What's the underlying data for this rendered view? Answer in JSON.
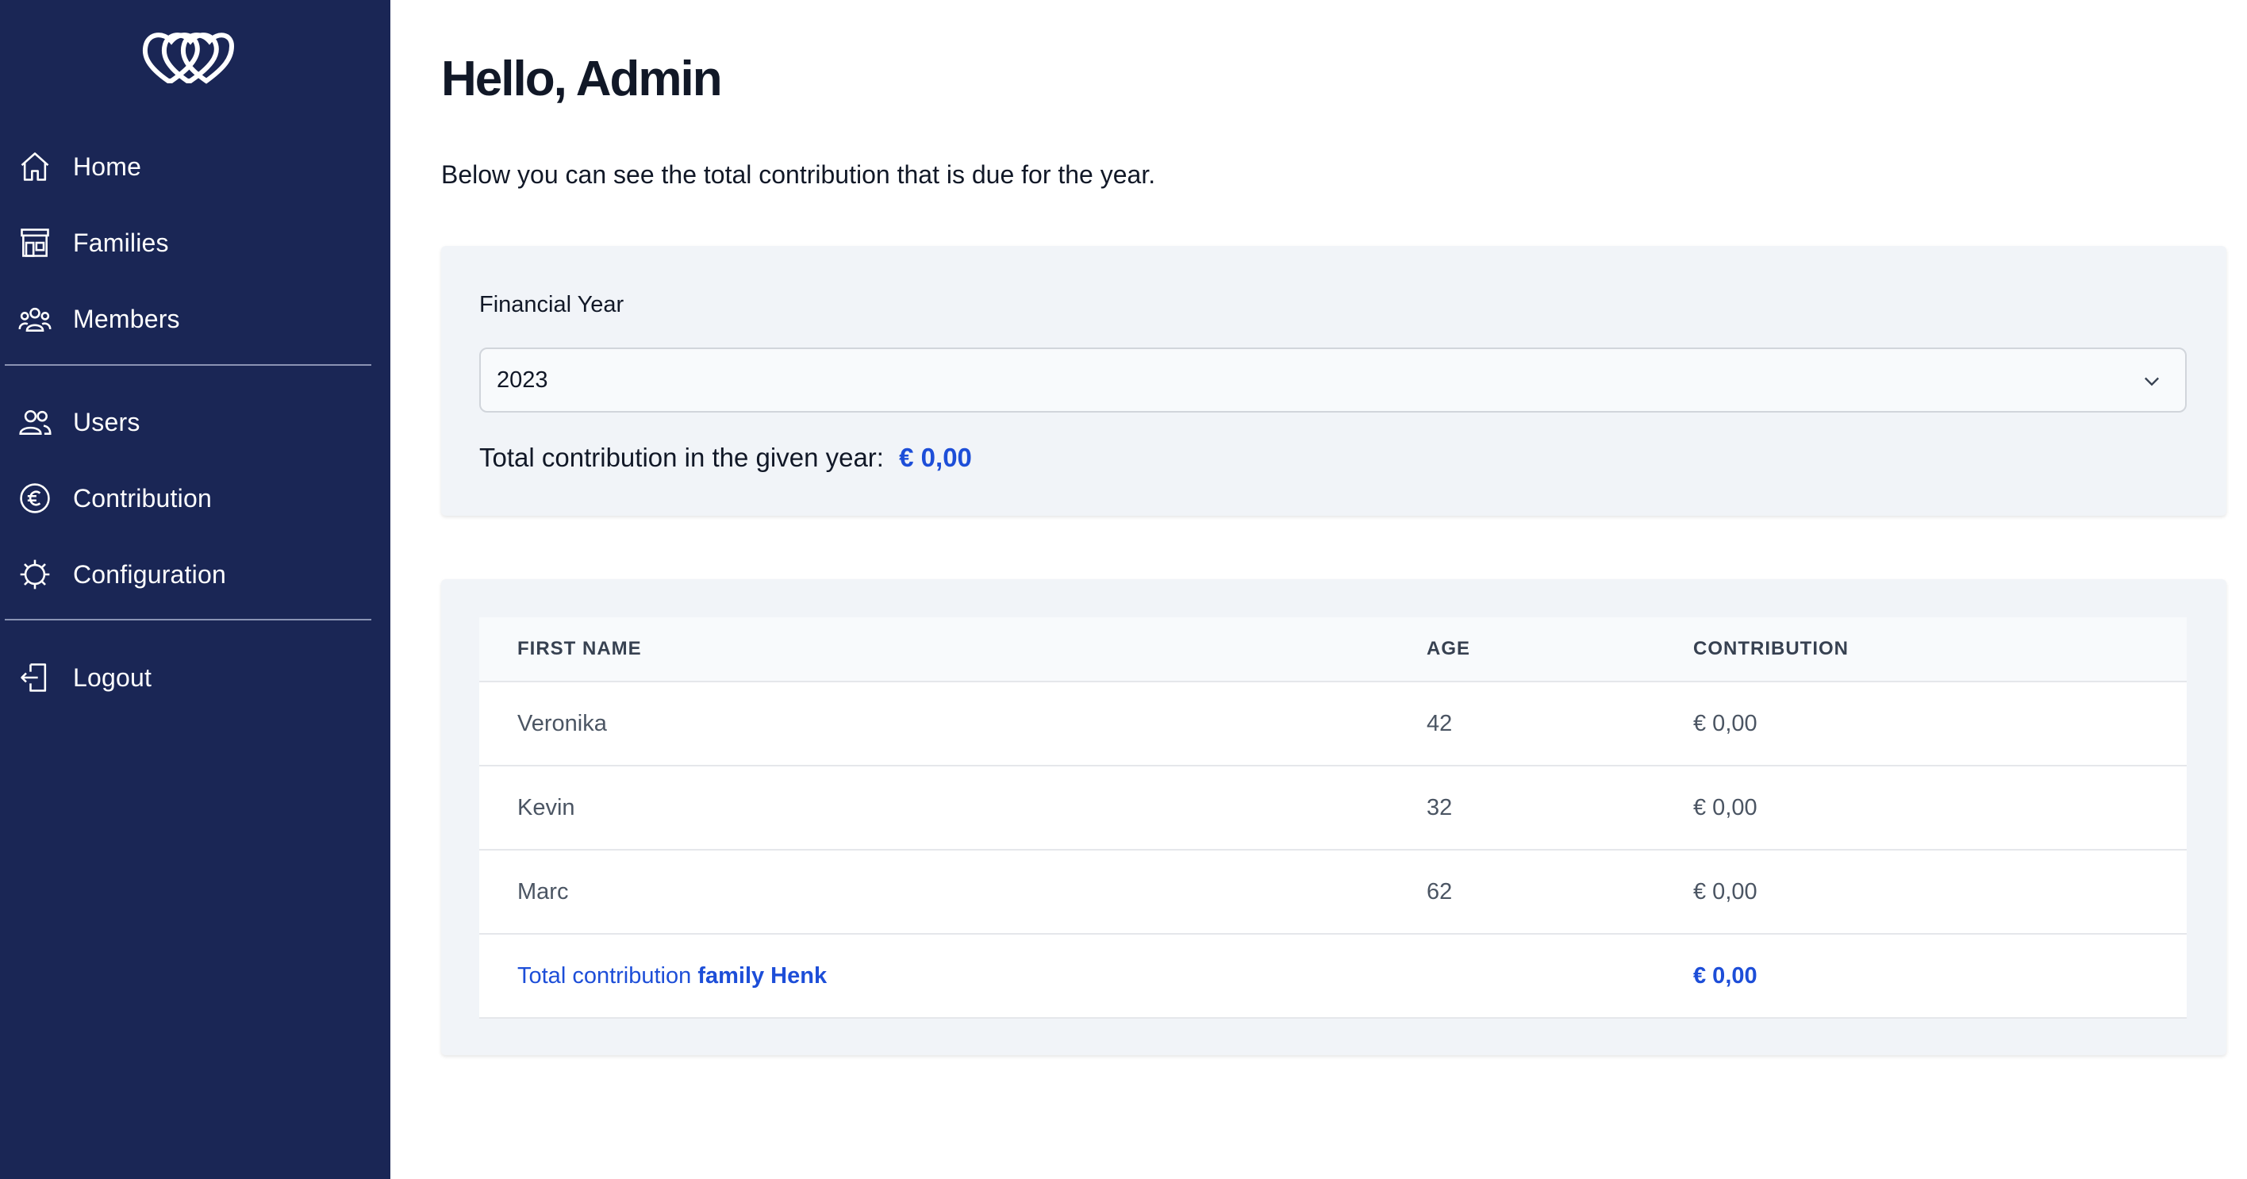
{
  "sidebar": {
    "nav_primary": [
      {
        "label": "Home",
        "icon": "home-icon"
      },
      {
        "label": "Families",
        "icon": "families-icon"
      },
      {
        "label": "Members",
        "icon": "members-icon"
      }
    ],
    "nav_secondary": [
      {
        "label": "Users",
        "icon": "users-icon"
      },
      {
        "label": "Contribution",
        "icon": "euro-icon"
      },
      {
        "label": "Configuration",
        "icon": "gear-icon"
      }
    ],
    "logout": {
      "label": "Logout",
      "icon": "logout-icon"
    }
  },
  "main": {
    "title": "Hello, Admin",
    "intro": "Below you can see the total contribution that is due for the year.",
    "year_card": {
      "field_label": "Financial Year",
      "selected_year": "2023",
      "total_label": "Total contribution in the given year:",
      "total_amount": "€ 0,00"
    },
    "table": {
      "headers": [
        "FIRST NAME",
        "AGE",
        "CONTRIBUTION"
      ],
      "rows": [
        {
          "first_name": "Veronika",
          "age": "42",
          "contribution": "€ 0,00"
        },
        {
          "first_name": "Kevin",
          "age": "32",
          "contribution": "€ 0,00"
        },
        {
          "first_name": "Marc",
          "age": "62",
          "contribution": "€ 0,00"
        }
      ],
      "total_row": {
        "prefix": "Total contribution",
        "family": "family Henk",
        "amount": "€ 0,00"
      }
    }
  },
  "colors": {
    "sidebar_bg": "#1a2655",
    "accent": "#1d4ed8",
    "card_bg": "#f1f4f8"
  }
}
